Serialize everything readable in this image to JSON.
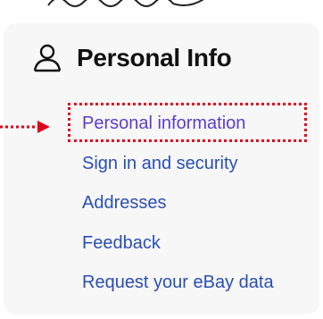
{
  "section": {
    "title": "Personal Info",
    "icon": "person-outline-icon"
  },
  "menu": {
    "items": [
      {
        "label": "Personal information",
        "active": true
      },
      {
        "label": "Sign in and security",
        "active": false
      },
      {
        "label": "Addresses",
        "active": false
      },
      {
        "label": "Feedback",
        "active": false
      },
      {
        "label": "Request your eBay data",
        "active": false
      }
    ]
  },
  "colors": {
    "link": "#2a4fb3",
    "active_link": "#5b3ec8",
    "annotation": "#e0001b",
    "panel_bg": "#f7f7f7",
    "title": "#111111"
  }
}
